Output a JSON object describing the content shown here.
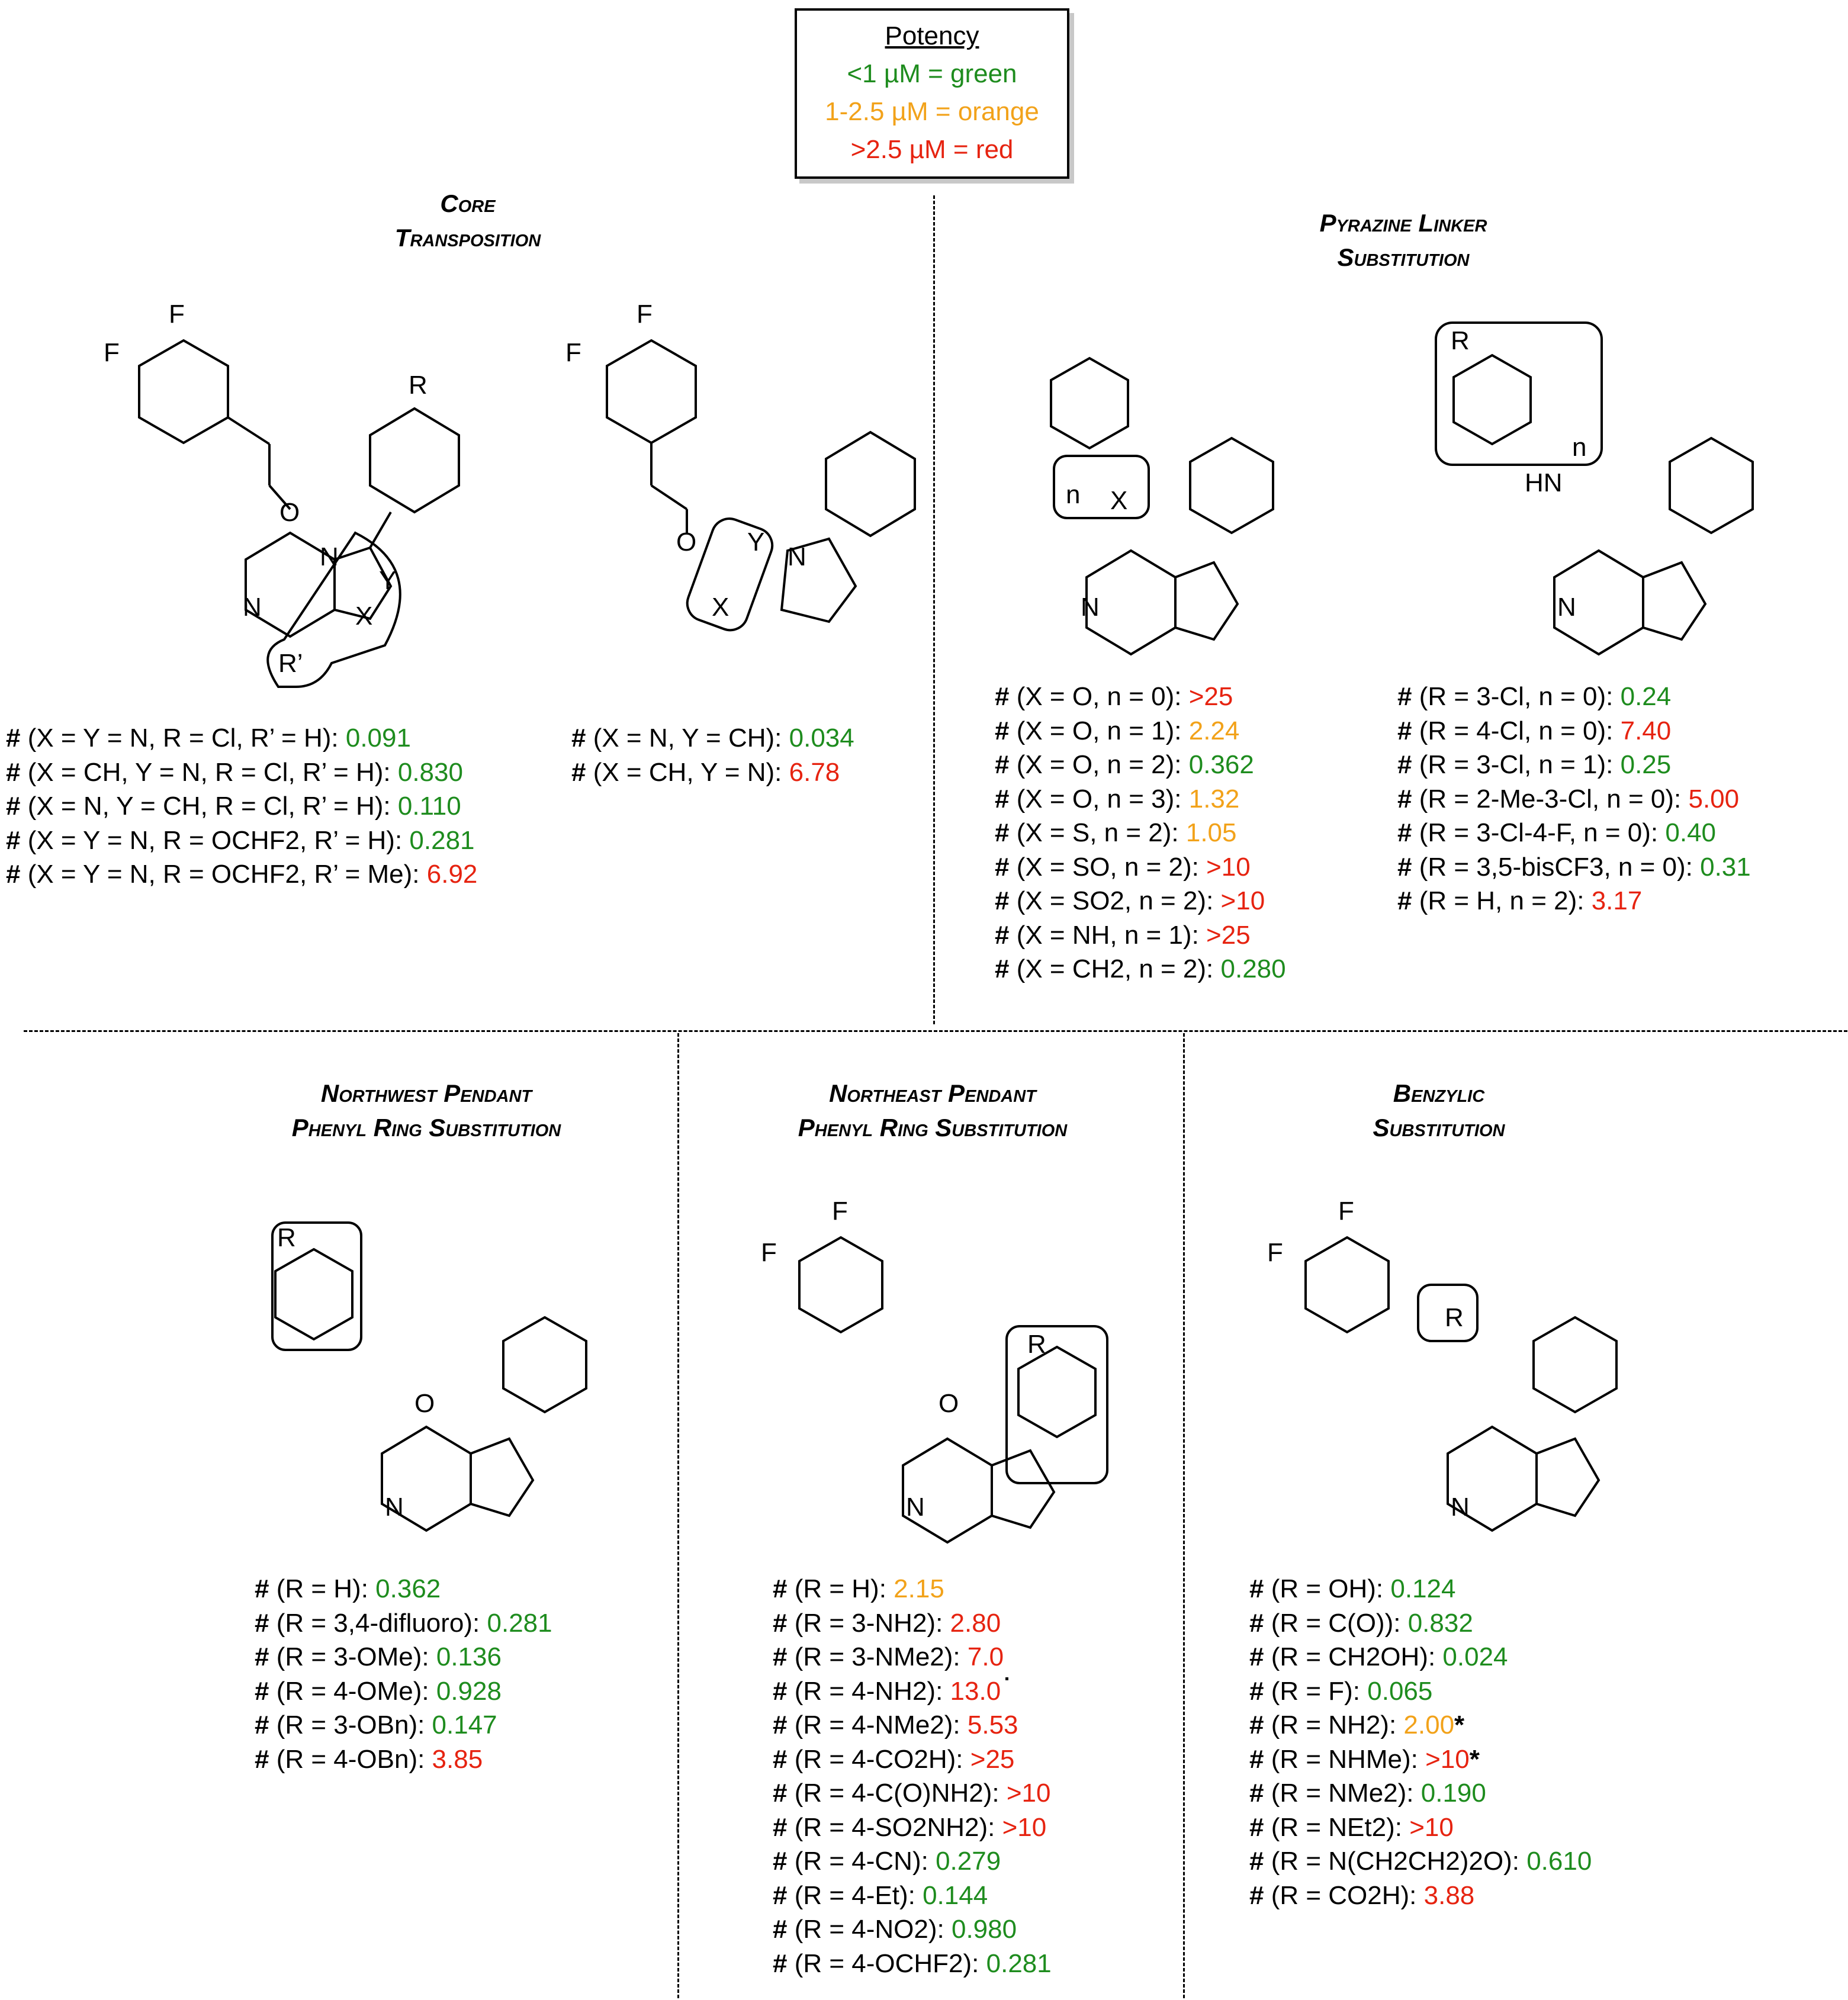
{
  "legend": {
    "title": "Potency",
    "rows": [
      {
        "text": "<1 µM = green",
        "color": "green"
      },
      {
        "text": "1-2.5 µM = orange",
        "color": "orange"
      },
      {
        "text": ">2.5 µM = red",
        "color": "red"
      }
    ]
  },
  "colors": {
    "green": "#1e8c1e",
    "orange": "#f2a21a",
    "red": "#e62310"
  },
  "sections": {
    "core": {
      "title_line1": "Core",
      "title_line2": "Transposition",
      "entries_a": [
        {
          "label": "(X = Y = N, R = Cl, R’ = H): ",
          "value": "0.091",
          "color": "green"
        },
        {
          "label": "(X = CH, Y = N, R = Cl, R’ = H): ",
          "value": "0.830",
          "color": "green"
        },
        {
          "label": "(X = N, Y = CH, R = Cl, R’ = H): ",
          "value": "0.110",
          "color": "green"
        },
        {
          "label": "(X = Y = N, R = OCHF2, R’ = H): ",
          "value": "0.281",
          "color": "green"
        },
        {
          "label": "(X = Y = N, R = OCHF2, R’ = Me): ",
          "value": "6.92",
          "color": "red"
        }
      ],
      "entries_b": [
        {
          "label": "(X = N, Y = CH): ",
          "value": "0.034",
          "color": "green"
        },
        {
          "label": "(X = CH, Y = N): ",
          "value": "6.78",
          "color": "red"
        }
      ]
    },
    "pyrazine": {
      "title_line1": "Pyrazine Linker",
      "title_line2": "Substitution",
      "entries_a": [
        {
          "label": "(X = O, n = 0): ",
          "value": ">25",
          "color": "red"
        },
        {
          "label": "(X = O, n = 1): ",
          "value": "2.24",
          "color": "orange"
        },
        {
          "label": "(X = O, n = 2): ",
          "value": "0.362",
          "color": "green"
        },
        {
          "label": "(X = O, n = 3): ",
          "value": "1.32",
          "color": "orange"
        },
        {
          "label": "(X = S, n = 2): ",
          "value": "1.05",
          "color": "orange"
        },
        {
          "label": "(X = SO, n = 2): ",
          "value": ">10",
          "color": "red"
        },
        {
          "label": "(X = SO2, n = 2): ",
          "value": ">10",
          "color": "red"
        },
        {
          "label": "(X = NH, n = 1): ",
          "value": ">25",
          "color": "red"
        },
        {
          "label": "(X = CH2, n = 2): ",
          "value": "0.280",
          "color": "green"
        }
      ],
      "entries_b": [
        {
          "label": "(R = 3-Cl, n = 0): ",
          "value": "0.24",
          "color": "green"
        },
        {
          "label": "(R = 4-Cl, n = 0): ",
          "value": "7.40",
          "color": "red"
        },
        {
          "label": "(R = 3-Cl, n = 1): ",
          "value": "0.25",
          "color": "green"
        },
        {
          "label": "(R = 2-Me-3-Cl, n = 0): ",
          "value": "5.00",
          "color": "red"
        },
        {
          "label": "(R = 3-Cl-4-F, n = 0): ",
          "value": "0.40",
          "color": "green"
        },
        {
          "label": "(R = 3,5-bisCF3, n = 0): ",
          "value": "0.31",
          "color": "green"
        },
        {
          "label": "(R = H, n = 2): ",
          "value": "3.17",
          "color": "red"
        }
      ]
    },
    "northwest": {
      "title_line1": "Northwest Pendant",
      "title_line2": "Phenyl Ring Substitution",
      "entries": [
        {
          "label": "(R = H): ",
          "value": "0.362",
          "color": "green"
        },
        {
          "label": "(R = 3,4-difluoro): ",
          "value": "0.281",
          "color": "green"
        },
        {
          "label": "(R = 3-OMe): ",
          "value": "0.136",
          "color": "green"
        },
        {
          "label": "(R = 4-OMe): ",
          "value": "0.928",
          "color": "green"
        },
        {
          "label": "(R = 3-OBn): ",
          "value": "0.147",
          "color": "green"
        },
        {
          "label": "(R = 4-OBn): ",
          "value": "3.85",
          "color": "red"
        }
      ]
    },
    "northeast": {
      "title_line1": "Northeast Pendant",
      "title_line2": "Phenyl Ring Substitution",
      "entries": [
        {
          "label": "(R = H): ",
          "value": "2.15",
          "color": "orange"
        },
        {
          "label": "(R = 3-NH2): ",
          "value": "2.80",
          "color": "red"
        },
        {
          "label": "(R = 3-NMe2): ",
          "value": "7.0",
          "color": "red"
        },
        {
          "label": "(R = 4-NH2): ",
          "value": "13.0",
          "color": "red"
        },
        {
          "label": "(R = 4-NMe2): ",
          "value": "5.53",
          "color": "red"
        },
        {
          "label": "(R = 4-CO2H): ",
          "value": ">25",
          "color": "red"
        },
        {
          "label": "(R = 4-C(O)NH2): ",
          "value": ">10",
          "color": "red"
        },
        {
          "label": "(R = 4-SO2NH2): ",
          "value": ">10",
          "color": "red"
        },
        {
          "label": "(R = 4-CN): ",
          "value": "0.279",
          "color": "green"
        },
        {
          "label": "(R = 4-Et): ",
          "value": "0.144",
          "color": "green"
        },
        {
          "label": "(R = 4-NO2): ",
          "value": "0.980",
          "color": "green"
        },
        {
          "label": "(R = 4-OCHF2): ",
          "value": "0.281",
          "color": "green"
        }
      ]
    },
    "benzylic": {
      "title_line1": "Benzylic",
      "title_line2": "Substitution",
      "entries": [
        {
          "label": "(R = OH): ",
          "value": "0.124",
          "color": "green"
        },
        {
          "label": "(R = C(O)): ",
          "value": "0.832",
          "color": "green"
        },
        {
          "label": "(R = CH2OH): ",
          "value": "0.024",
          "color": "green"
        },
        {
          "label": "(R = F): ",
          "value": "0.065",
          "color": "green"
        },
        {
          "label": "(R = NH2): ",
          "value": "2.00",
          "color": "orange",
          "suffix": "*"
        },
        {
          "label": "(R = NHMe): ",
          "value": ">10",
          "color": "red",
          "suffix": "*"
        },
        {
          "label": "(R = NMe2): ",
          "value": "0.190",
          "color": "green"
        },
        {
          "label": "(R = NEt2): ",
          "value": ">10",
          "color": "red"
        },
        {
          "label": "(R = N(CH2CH2)2O): ",
          "value": "0.610",
          "color": "green"
        },
        {
          "label": "(R = CO2H): ",
          "value": "3.88",
          "color": "red"
        }
      ]
    }
  },
  "structure_labels": {
    "F": "F",
    "O": "O",
    "N": "N",
    "R": "R",
    "R_prime": "R’",
    "X": "X",
    "Y": "Y",
    "n": "n",
    "HN": "HN",
    "hash": "#"
  }
}
